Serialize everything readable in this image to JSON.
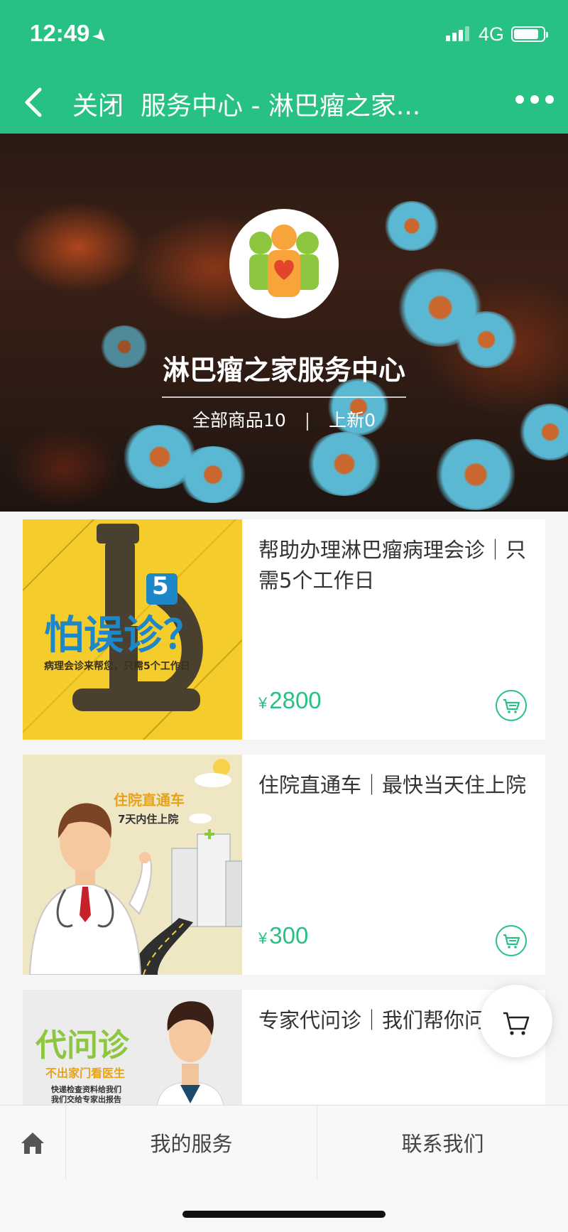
{
  "status": {
    "time": "12:49",
    "network": "4G"
  },
  "nav": {
    "close_label": "关闭",
    "title": "服务中心 - 淋巴瘤之家..."
  },
  "shop": {
    "name": "淋巴瘤之家服务中心",
    "all_products": "全部商品10",
    "new_items": "上新0"
  },
  "currency": "¥",
  "products": [
    {
      "title": "帮助办理淋巴瘤病理会诊｜只需5个工作日",
      "price": "2800",
      "image_text": {
        "badge": "5",
        "headline": "怕误诊？",
        "sub": "病理会诊来帮您，只需5个工作日"
      }
    },
    {
      "title": "住院直通车｜最快当天住上院",
      "price": "300",
      "image_text": {
        "headline": "住院直通车",
        "sub": "7天内住上院"
      }
    },
    {
      "title": "专家代问诊｜我们帮你问家",
      "image_text": {
        "headline": "代问诊",
        "sub": "不出家门看医生",
        "line1": "快递检查资料给我们",
        "line2": "我们交给专家出报告"
      }
    }
  ],
  "tabs": {
    "my_services": "我的服务",
    "contact_us": "联系我们"
  },
  "colors": {
    "brand_green": "#26c183",
    "card_yellow": "#f4cc2c",
    "card_beige": "#efe6c4",
    "orange_title": "#e7a317",
    "blue_title": "#1d87c8"
  },
  "icons": [
    "location-arrow-icon",
    "signal-icon",
    "battery-icon",
    "back-chevron-icon",
    "more-icon",
    "cart-icon",
    "home-icon"
  ]
}
